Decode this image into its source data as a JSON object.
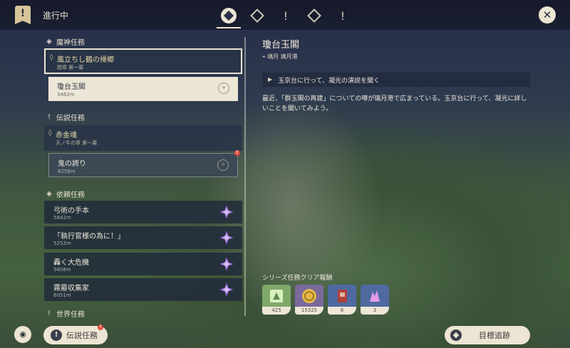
{
  "header": {
    "title": "進行中",
    "tabs": [
      {
        "name": "tab-all",
        "icon": "gem-icon",
        "glyph": ""
      },
      {
        "name": "tab-archon",
        "icon": "archon-diamond-icon",
        "glyph": ""
      },
      {
        "name": "tab-story",
        "icon": "exclamation-icon",
        "glyph": "!"
      },
      {
        "name": "tab-world-diamond",
        "icon": "diamond-icon",
        "glyph": ""
      },
      {
        "name": "tab-world",
        "icon": "exclamation-icon",
        "glyph": "!"
      }
    ],
    "close_glyph": "✕"
  },
  "quest_list": {
    "archon": {
      "category": "魔神任務",
      "chapter_name": "風立ちし鶴の帰郷",
      "chapter_sub": "間章 第一幕",
      "sub_name": "瓊台玉閣",
      "sub_dist": "3462m"
    },
    "legend": {
      "category": "伝説任務",
      "chapter_name": "赤金魂",
      "chapter_sub": "天ノ牛の章 第一幕",
      "sub_name": "鬼の誇り",
      "sub_dist": "6256m",
      "badge": "!"
    },
    "commission": {
      "category": "依頼任務",
      "items": [
        {
          "name": "弓術の手本",
          "dist": "5842m"
        },
        {
          "name": "「執行官様の為に！」",
          "dist": "5252m"
        },
        {
          "name": "轟く大危機",
          "dist": "5608m"
        },
        {
          "name": "霧靂収集家",
          "dist": "6051m"
        }
      ]
    },
    "world": {
      "category": "世界任務"
    }
  },
  "detail": {
    "title": "瓊台玉閣",
    "location": "璃月 璃月港",
    "objective": "玉京台に行って、凝光の演説を聞く",
    "description": "最近、「群玉閣の再建」についての噂が璃月港で広まっている。玉京台に行って、凝光に詳しいことを聞いてみよう。",
    "rewards_title": "シリーズ任務クリア報酬",
    "rewards": [
      {
        "name": "adventure-exp",
        "count": "425",
        "color": "#6aa86a"
      },
      {
        "name": "mora",
        "count": "15325",
        "color": "#7a6a9c"
      },
      {
        "name": "item-card",
        "count": "6",
        "color": "#4e6aa0"
      },
      {
        "name": "crystal",
        "count": "3",
        "color": "#4e6aa0"
      }
    ]
  },
  "footer": {
    "legend_button": "伝説任務",
    "legend_badge": "!",
    "track_button": "目標追跡"
  }
}
